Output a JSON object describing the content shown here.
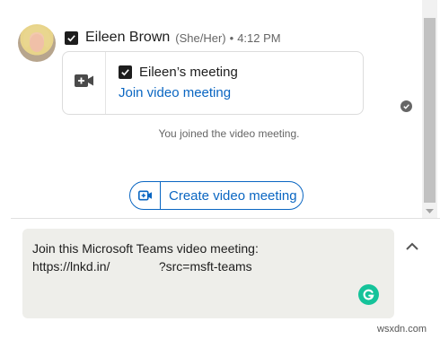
{
  "message": {
    "sender_name": "Eileen Brown",
    "pronouns": "(She/Her)",
    "separator": "•",
    "time": "4:12 PM",
    "card": {
      "title": "Eileen’s meeting",
      "link_label": "Join video meeting",
      "icon": "video-camera-plus-icon"
    }
  },
  "status": "You joined the video meeting.",
  "create_button": {
    "label": "Create video meeting",
    "icon": "video-camera-icon"
  },
  "composer": {
    "value": "Join this Microsoft Teams video meeting:\nhttps://lnkd.in/              ?src=msft-teams",
    "grammarly_icon": "grammarly-icon"
  },
  "watermark": "wsxdn.com",
  "colors": {
    "accent": "#0a66c2",
    "grammarly": "#15c39a",
    "composer_bg": "#eeeeea"
  }
}
